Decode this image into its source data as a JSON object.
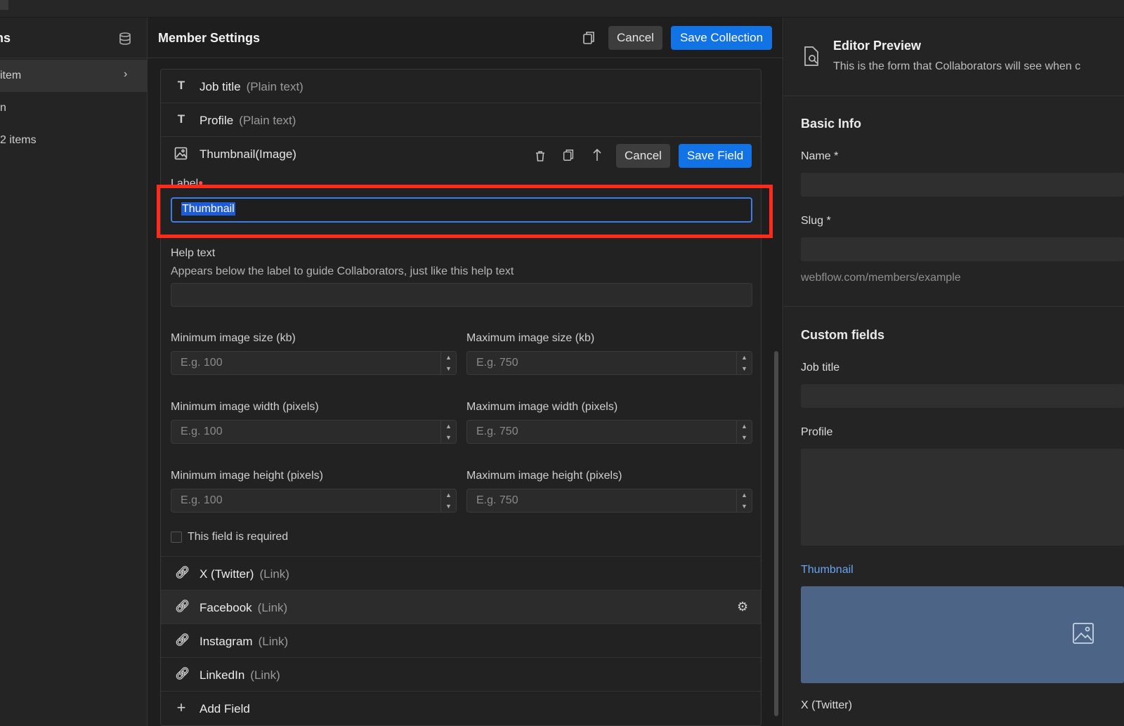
{
  "sidebar": {
    "title": "ns",
    "items": [
      {
        "label": "item"
      },
      {
        "label": "n"
      },
      {
        "label": "2 items"
      }
    ]
  },
  "header": {
    "title": "Member Settings",
    "cancel_label": "Cancel",
    "save_label": "Save Collection"
  },
  "fields": {
    "before": [
      {
        "icon": "T",
        "name": "Job title",
        "type": "(Plain text)"
      },
      {
        "icon": "T",
        "name": "Profile",
        "type": "(Plain text)"
      }
    ],
    "editing": {
      "name": "Thumbnail",
      "type": "(Image)",
      "cancel_label": "Cancel",
      "save_label": "Save Field",
      "label_title": "Label",
      "label_value": "Thumbnail",
      "help_title": "Help text",
      "help_desc": "Appears below the label to guide Collaborators, just like this help text",
      "help_value": "",
      "min_size_label": "Minimum image size (kb)",
      "max_size_label": "Maximum image size (kb)",
      "min_width_label": "Minimum image width (pixels)",
      "max_width_label": "Maximum image width (pixels)",
      "min_height_label": "Minimum image height (pixels)",
      "max_height_label": "Maximum image height (pixels)",
      "min_placeholder": "E.g. 100",
      "max_placeholder": "E.g. 750",
      "required_label": "This field is required"
    },
    "after": [
      {
        "name": "X (Twitter)",
        "type": "(Link)"
      },
      {
        "name": "Facebook",
        "type": "(Link)"
      },
      {
        "name": "Instagram",
        "type": "(Link)"
      },
      {
        "name": "LinkedIn",
        "type": "(Link)"
      }
    ],
    "add_label": "Add Field"
  },
  "preview": {
    "title": "Editor Preview",
    "subtitle": "This is the form that Collaborators will see when c",
    "basic_info": "Basic Info",
    "name_label": "Name *",
    "slug_label": "Slug *",
    "slug_hint": "webflow.com/members/example",
    "custom_fields": "Custom fields",
    "job_title": "Job title",
    "profile": "Profile",
    "thumbnail": "Thumbnail",
    "twitter": "X (Twitter)",
    "thumbnail_color": "#4c6486",
    "accent": "#1273e6"
  }
}
